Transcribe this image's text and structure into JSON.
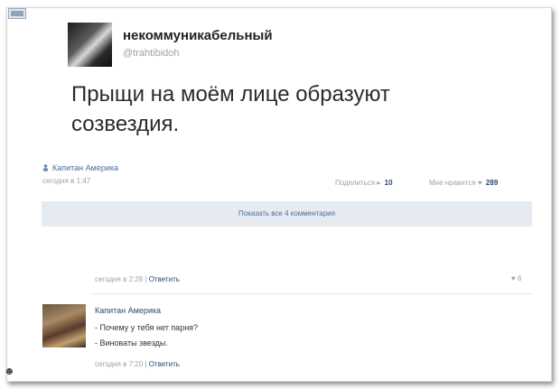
{
  "post": {
    "username": "некоммуникабельный",
    "handle": "@trahtibidoh",
    "text": "Прыщи на моём лице образуют созвездия.",
    "author": "Капитан Америка",
    "time": "сегодня в 1:47",
    "share_label": "Поделиться",
    "share_count": "10",
    "like_label": "Мне нравится",
    "like_count": "289",
    "show_comments": "Показать все 4 комментария",
    "footer_time": "сегодня в 2:28",
    "reply_label": "Ответить",
    "likes_on_footer": "6"
  },
  "comment": {
    "author": "Капитан Америка",
    "lines": [
      "- Почему у тебя нет парня?",
      "- Виноваты звезды."
    ],
    "time": "сегодня в 7:20",
    "reply_label": "Ответить"
  },
  "icons": {
    "corner": "image-icon",
    "author_person": "person-icon",
    "share": "megaphone-icon",
    "heart": "heart-icon",
    "bottom": "smiley-icon"
  },
  "colors": {
    "link": "#2b4a70",
    "muted": "#9aa3ad",
    "bar": "#e5ebf1"
  }
}
